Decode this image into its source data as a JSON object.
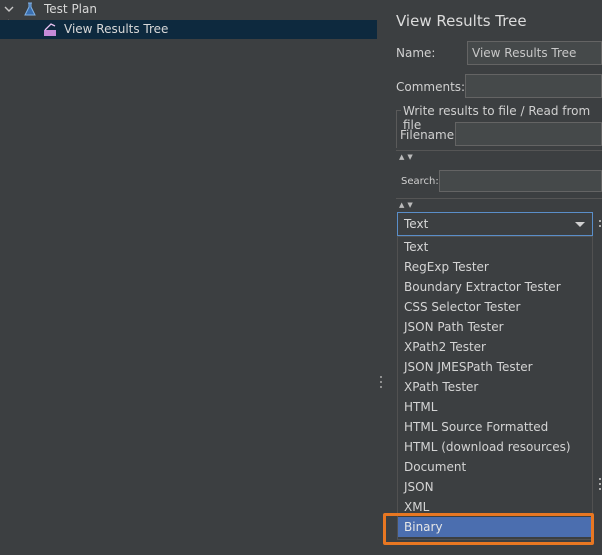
{
  "tree": {
    "items": [
      {
        "label": "Test Plan",
        "icon": "flask-icon"
      },
      {
        "label": "View Results Tree",
        "icon": "results-tree-icon"
      }
    ]
  },
  "panel": {
    "title": "View Results Tree",
    "name_label": "Name:",
    "name_value": "View Results Tree",
    "comments_label": "Comments:",
    "comments_value": "",
    "file_group_title": "Write results to file / Read from file",
    "filename_label": "Filename",
    "filename_value": "",
    "search_label": "Search:",
    "search_value": ""
  },
  "renderer": {
    "selected": "Text",
    "options": [
      "Text",
      "RegExp Tester",
      "Boundary Extractor Tester",
      "CSS Selector Tester",
      "JSON Path Tester",
      "XPath2 Tester",
      "JSON JMESPath Tester",
      "XPath Tester",
      "HTML",
      "HTML Source Formatted",
      "HTML (download resources)",
      "Document",
      "JSON",
      "XML",
      "Binary"
    ],
    "highlighted_option": "Binary"
  },
  "colors": {
    "selection": "#4b6eaf",
    "tree_selection": "#0d293e",
    "callout": "#e87722"
  }
}
